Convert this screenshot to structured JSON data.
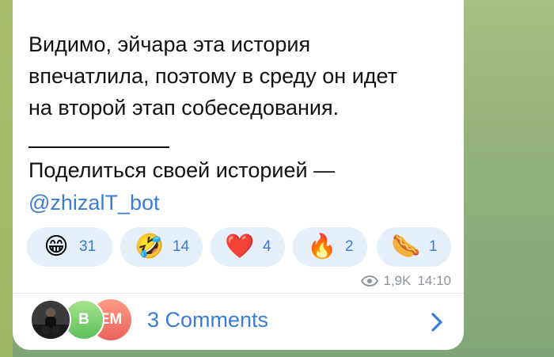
{
  "post": {
    "text": "Видимо, эйчара эта история\nвпечатлила, поэтому в среду он идет\nна второй этап собеседования.",
    "share_text": "Поделиться своей историей —",
    "bot_link": "@zhizalT_bot"
  },
  "reactions": [
    {
      "emoji": "😁",
      "icon": "grinning-face-icon",
      "count": "31"
    },
    {
      "emoji": "🤣",
      "icon": "rolling-laughing-icon",
      "count": "14"
    },
    {
      "emoji": "❤️",
      "icon": "red-heart-icon",
      "count": "4"
    },
    {
      "emoji": "🔥",
      "icon": "fire-icon",
      "count": "2"
    },
    {
      "emoji": "🌭",
      "icon": "hotdog-icon",
      "count": "1"
    }
  ],
  "meta": {
    "views": "1,9K",
    "time": "14:10"
  },
  "comments": {
    "label": "3 Comments",
    "avatars": [
      {
        "icon": "user-photo-avatar",
        "initials": ""
      },
      {
        "icon": "initials-avatar",
        "initials": "B"
      },
      {
        "icon": "initials-avatar",
        "initials": "EM"
      }
    ]
  },
  "colors": {
    "accent": "#3a7bd5",
    "reaction_bg": "#e4effa",
    "meta": "#8d9399",
    "background": "#95b27c"
  }
}
